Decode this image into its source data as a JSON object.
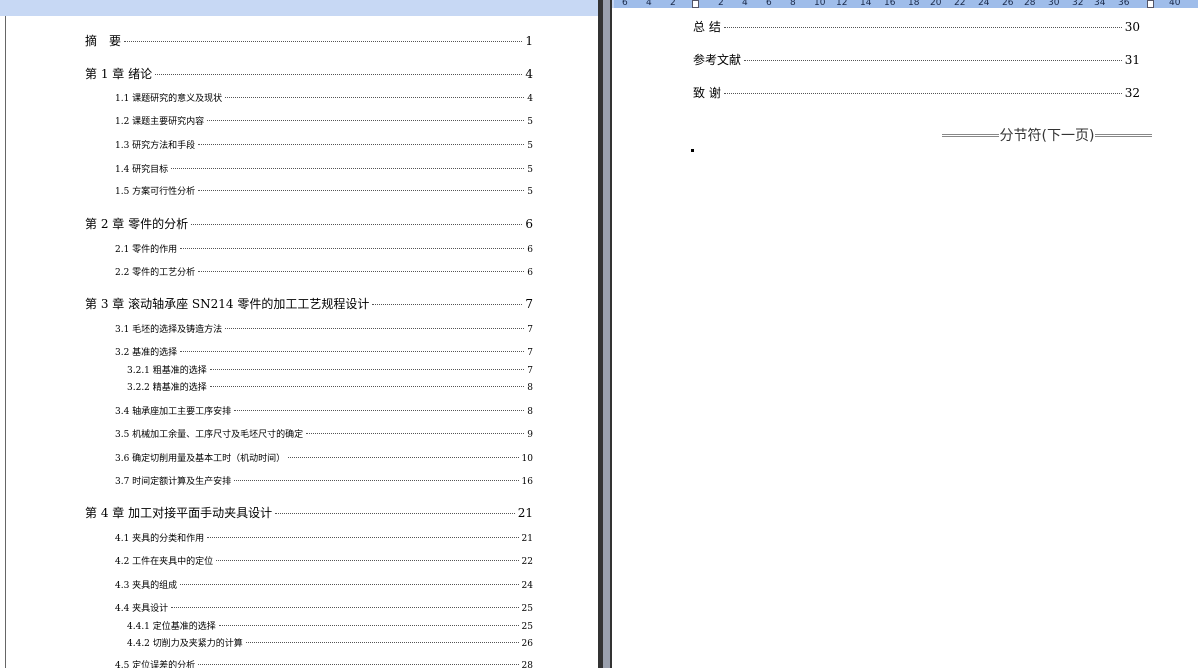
{
  "ruler": {
    "ticks": [
      "6",
      "4",
      "2",
      "2",
      "4",
      "6",
      "8",
      "10",
      "12",
      "14",
      "16",
      "18",
      "20",
      "22",
      "24",
      "26",
      "28",
      "30",
      "32",
      "34",
      "36",
      "40"
    ]
  },
  "left_toc": [
    {
      "label": "摘　要",
      "page": "1",
      "level": 1
    },
    {
      "label": "第 1 章  绪论",
      "page": "4",
      "level": 1
    },
    {
      "label": "1.1 课题研究的意义及现状",
      "page": "4",
      "level": 2
    },
    {
      "label": "1.2 课题主要研究内容",
      "page": "5",
      "level": 2
    },
    {
      "label": "1.3 研究方法和手段",
      "page": "5",
      "level": 2
    },
    {
      "label": "1.4 研究目标",
      "page": "5",
      "level": 2
    },
    {
      "label": "1.5 方案可行性分析",
      "page": "5",
      "level": 2
    },
    {
      "label": "第 2 章  零件的分析",
      "page": "6",
      "level": 1
    },
    {
      "label": "2.1  零件的作用",
      "page": "6",
      "level": 2
    },
    {
      "label": "2.2  零件的工艺分析",
      "page": "6",
      "level": 2
    },
    {
      "label": "第 3 章  滚动轴承座 SN214 零件的加工工艺规程设计",
      "page": "7",
      "level": 1
    },
    {
      "label": "3.1 毛坯的选择及铸造方法",
      "page": "7",
      "level": 2
    },
    {
      "label": "3.2 基准的选择",
      "page": "7",
      "level": 2
    },
    {
      "label": "3.2.1 粗基准的选择",
      "page": "7",
      "level": 3
    },
    {
      "label": "3.2.2 精基准的选择",
      "page": "8",
      "level": 3
    },
    {
      "label": "3.4  轴承座加工主要工序安排",
      "page": "8",
      "level": 2
    },
    {
      "label": "3.5  机械加工余量、工序尺寸及毛坯尺寸的确定",
      "page": "9",
      "level": 2
    },
    {
      "label": "3.6 确定切削用量及基本工时（机动时间）",
      "page": "10",
      "level": 2
    },
    {
      "label": "3.7  时间定额计算及生产安排",
      "page": "16",
      "level": 2
    },
    {
      "label": "第 4 章  加工对接平面手动夹具设计",
      "page": "21",
      "level": 1
    },
    {
      "label": "4.1  夹具的分类和作用",
      "page": "21",
      "level": 2
    },
    {
      "label": "4.2  工件在夹具中的定位",
      "page": "22",
      "level": 2
    },
    {
      "label": "4.3  夹具的组成",
      "page": "24",
      "level": 2
    },
    {
      "label": "4.4 夹具设计",
      "page": "25",
      "level": 2
    },
    {
      "label": "4.4.1 定位基准的选择",
      "page": "25",
      "level": 3
    },
    {
      "label": "4.4.2 切削力及夹紧力的计算",
      "page": "26",
      "level": 3
    },
    {
      "label": "4.5 定位误差的分析",
      "page": "28",
      "level": 2
    }
  ],
  "right_toc": [
    {
      "label": "总  结",
      "page": "30",
      "level": 1
    },
    {
      "label": "参考文献",
      "page": "31",
      "level": 1
    },
    {
      "label": "致  谢",
      "page": "32",
      "level": 1
    }
  ],
  "section_break": "分节符(下一页)"
}
